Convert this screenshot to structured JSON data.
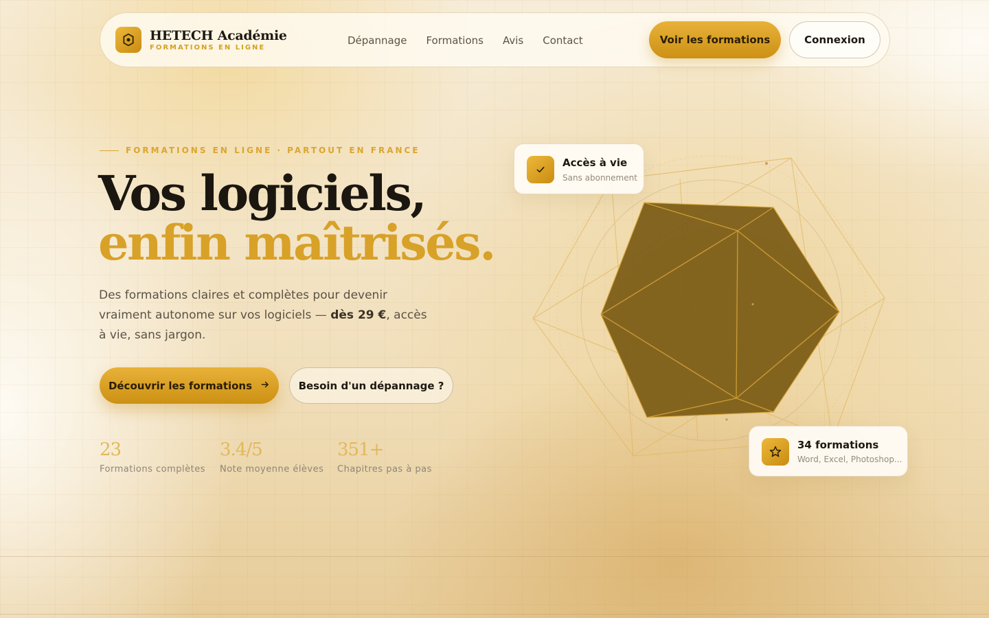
{
  "brand": {
    "name": "HETECH Académie",
    "tagline": "FORMATIONS EN LIGNE"
  },
  "nav": {
    "links": [
      "Dépannage",
      "Formations",
      "Avis",
      "Contact"
    ],
    "primary_button": "Voir les formations",
    "login_button": "Connexion"
  },
  "hero": {
    "eyebrow": "FORMATIONS EN LIGNE · PARTOUT EN FRANCE",
    "title_line1": "Vos logiciels,",
    "title_line2": "enfin maîtrisés.",
    "lead_part1": "Des formations claires et complètes pour devenir vraiment autonome sur vos logiciels — ",
    "lead_bold": "dès 29 €",
    "lead_part2": ", accès à vie, sans jargon.",
    "cta_primary": "Découvrir les formations",
    "cta_secondary": "Besoin d'un dépannage ?"
  },
  "stats": [
    {
      "value": "23",
      "label": "Formations complètes"
    },
    {
      "value": "3.4/5",
      "label": "Note moyenne élèves"
    },
    {
      "value": "351+",
      "label": "Chapitres pas à pas"
    }
  ],
  "cards": {
    "access": {
      "title": "Accès à vie",
      "subtitle": "Sans abonnement"
    },
    "formations": {
      "title": "34 formations",
      "subtitle": "Word, Excel, Photoshop..."
    }
  },
  "colors": {
    "accent": "#d8a128",
    "accent_dark": "#c98c12",
    "text": "#1b1710",
    "polyhedron": "#7a5a14"
  },
  "icons": {
    "logo": "shield-hexagon-icon",
    "cta_arrow": "arrow-right-icon",
    "access_card": "check-icon",
    "formations_card": "star-icon"
  }
}
